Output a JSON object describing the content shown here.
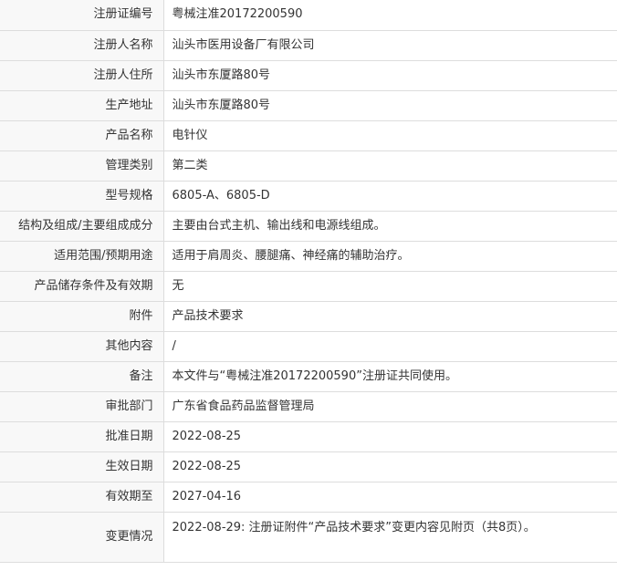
{
  "rows": [
    {
      "label": "注册证编号",
      "value": "粤械注准20172200590"
    },
    {
      "label": "注册人名称",
      "value": "汕头市医用设备厂有限公司"
    },
    {
      "label": "注册人住所",
      "value": "汕头市东厦路80号"
    },
    {
      "label": "生产地址",
      "value": "汕头市东厦路80号"
    },
    {
      "label": "产品名称",
      "value": "电针仪"
    },
    {
      "label": "管理类别",
      "value": "第二类"
    },
    {
      "label": "型号规格",
      "value": "6805-A、6805-D"
    },
    {
      "label": "结构及组成/主要组成成分",
      "value": "主要由台式主机、输出线和电源线组成。"
    },
    {
      "label": "适用范围/预期用途",
      "value": "适用于肩周炎、腰腿痛、神经痛的辅助治疗。"
    },
    {
      "label": "产品储存条件及有效期",
      "value": "无"
    },
    {
      "label": "附件",
      "value": "产品技术要求"
    },
    {
      "label": "其他内容",
      "value": "/"
    },
    {
      "label": "备注",
      "value": "本文件与“粤械注准20172200590”注册证共同使用。"
    },
    {
      "label": "审批部门",
      "value": "广东省食品药品监督管理局"
    },
    {
      "label": "批准日期",
      "value": "2022-08-25"
    },
    {
      "label": "生效日期",
      "value": "2022-08-25"
    },
    {
      "label": "有效期至",
      "value": "2027-04-16"
    },
    {
      "label": "变更情况",
      "value": "2022-08-29: 注册证附件“产品技术要求”变更内容见附页（共8页）。"
    }
  ]
}
